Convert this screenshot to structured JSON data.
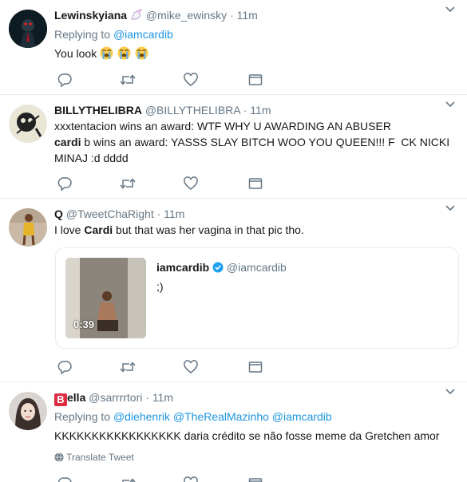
{
  "tweets": [
    {
      "name": "Lewinskyiana",
      "handle": "@mike_ewinsky",
      "time": "11m",
      "replying_label": "Replying to",
      "replying_to": "@iamcardib",
      "text": "You look",
      "emojis": [
        "loudly-crying-face",
        "loudly-crying-face",
        "loudly-crying-face"
      ]
    },
    {
      "name": "BILLYTHELIBRA",
      "handle": "@BILLYTHELIBRA",
      "time": "11m",
      "text_line1": "xxxtentacion wins an award: WTF WHY U AWARDING AN ABUSER",
      "text_line2_bold": "cardi",
      "text_line2": " b wins an award: YASSS SLAY BITCH WOO YOU QUEEN!!! F  CK NICKI",
      "text_line3": "MINAJ :d dddd"
    },
    {
      "name": "Q",
      "handle": "@TweetChaRight",
      "time": "11m",
      "text_pre": "I love ",
      "text_bold": "Cardi",
      "text_post": " but that was her vagina in that pic tho.",
      "quoted": {
        "name": "iamcardib",
        "handle": "@iamcardib",
        "text": ";)",
        "duration": "0:39"
      }
    },
    {
      "name": "ella",
      "name_badge": "B",
      "handle": "@sarrrrtori",
      "time": "11m",
      "replying_label": "Replying to",
      "replying_to": [
        "@diehenrik",
        "@TheRealMazinho",
        "@iamcardib"
      ],
      "text": "KKKKKKKKKKKKKKKKK daria crédito se não fosse meme da Gretchen amor",
      "translate": "Translate Tweet"
    }
  ],
  "dot": "·",
  "colors": {
    "link": "#1b95e0",
    "muted": "#657786",
    "border": "#e6ecf0"
  },
  "actions": [
    "reply-icon",
    "retweet-icon",
    "like-icon",
    "dm-icon"
  ]
}
